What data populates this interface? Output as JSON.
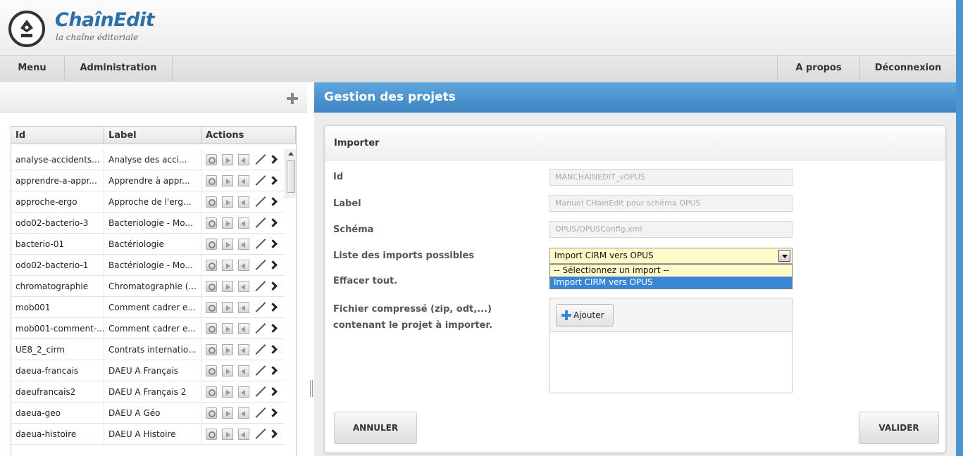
{
  "app": {
    "title": "ChaînEdit",
    "subtitle": "la chaîne éditoriale"
  },
  "menu": {
    "left": [
      "Menu",
      "Administration"
    ],
    "right": [
      "A propos",
      "Déconnexion"
    ]
  },
  "projects_table": {
    "columns": [
      "Id",
      "Label",
      "Actions"
    ],
    "rows": [
      {
        "id": "analyse-accidents...",
        "label": "Analyse des acci..."
      },
      {
        "id": "apprendre-a-appr...",
        "label": "Apprendre à appr..."
      },
      {
        "id": "approche-ergo",
        "label": "Approche de l'erg..."
      },
      {
        "id": "odo02-bacterio-3",
        "label": "Bacteriologie - Mo..."
      },
      {
        "id": "bacterio-01",
        "label": "Bactériologie"
      },
      {
        "id": "odo02-bacterio-1",
        "label": "Bactériologie - Mo..."
      },
      {
        "id": "chromatographie",
        "label": "Chromatographie (..."
      },
      {
        "id": "mob001",
        "label": "Comment cadrer e..."
      },
      {
        "id": "mob001-comment-...",
        "label": "Comment cadrer e..."
      },
      {
        "id": "UE8_2_cirm",
        "label": "Contrats internatio..."
      },
      {
        "id": "daeua-francais",
        "label": "DAEU A Français"
      },
      {
        "id": "daeufrancais2",
        "label": "DAEU A Français 2"
      },
      {
        "id": "daeua-geo",
        "label": "DAEU A Géo"
      },
      {
        "id": "daeua-histoire",
        "label": "DAEU A Histoire"
      }
    ],
    "action_icons": [
      "open-project-icon",
      "export-icon",
      "import-icon",
      "edit-icon",
      "more-icon"
    ]
  },
  "panel": {
    "title": "Gestion des projets",
    "section": "Importer",
    "fields": {
      "id_label": "Id",
      "id_value": "MANCHAINEDIT_vOPUS",
      "label_label": "Label",
      "label_value": "Manuel CHainEdit pour schéma OPUS",
      "schema_label": "Schéma",
      "schema_value": "OPUS/OPUSConfig.xml",
      "imports_label": "Liste des imports possibles",
      "imports_selected": "Import CIRM vers OPUS",
      "imports_options": [
        "-- Sélectionnez un import --",
        "Import CIRM vers OPUS"
      ],
      "clear_label": "Effacer tout.",
      "file_label": "Fichier compressé (zip, odt,...) contenant le projet à importer.",
      "add_button": "Ajouter"
    },
    "buttons": {
      "cancel": "ANNULER",
      "submit": "VALIDER"
    }
  },
  "colors": {
    "brand_blue": "#2d6fa8",
    "panel_header": "#4a95d2",
    "select_bg": "#fffbc9",
    "option_highlight": "#3a86d4"
  }
}
